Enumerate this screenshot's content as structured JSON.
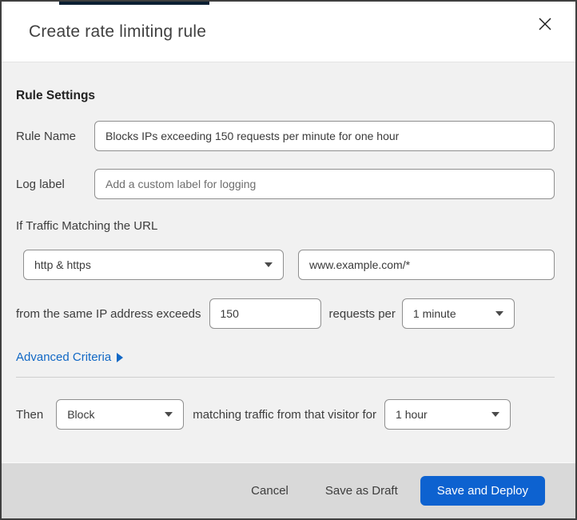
{
  "dialog": {
    "title": "Create rate limiting rule"
  },
  "rule_settings": {
    "heading": "Rule Settings",
    "rule_name": {
      "label": "Rule Name",
      "value": "Blocks IPs exceeding 150 requests per minute for one hour"
    },
    "log_label": {
      "label": "Log label",
      "placeholder": "Add a custom label for logging"
    }
  },
  "match": {
    "intro": "If Traffic Matching the URL",
    "scheme_selected": "http & https",
    "url_value": "www.example.com/*",
    "threshold_text": "from the same IP address exceeds",
    "threshold_value": "150",
    "requests_per_text": "requests per",
    "period_selected": "1 minute",
    "advanced_link": "Advanced Criteria"
  },
  "action": {
    "then_label": "Then",
    "action_selected": "Block",
    "middle_text": "matching traffic from that visitor for",
    "duration_selected": "1 hour"
  },
  "footer": {
    "cancel_label": "Cancel",
    "save_draft_label": "Save as Draft",
    "save_deploy_label": "Save and Deploy"
  },
  "colors": {
    "primary_button_blue": "#0d62d0",
    "link_blue": "#1168c5",
    "body_background": "#f1f1f1",
    "footer_background": "#d9d9d9",
    "top_accent": "#0c2033"
  }
}
